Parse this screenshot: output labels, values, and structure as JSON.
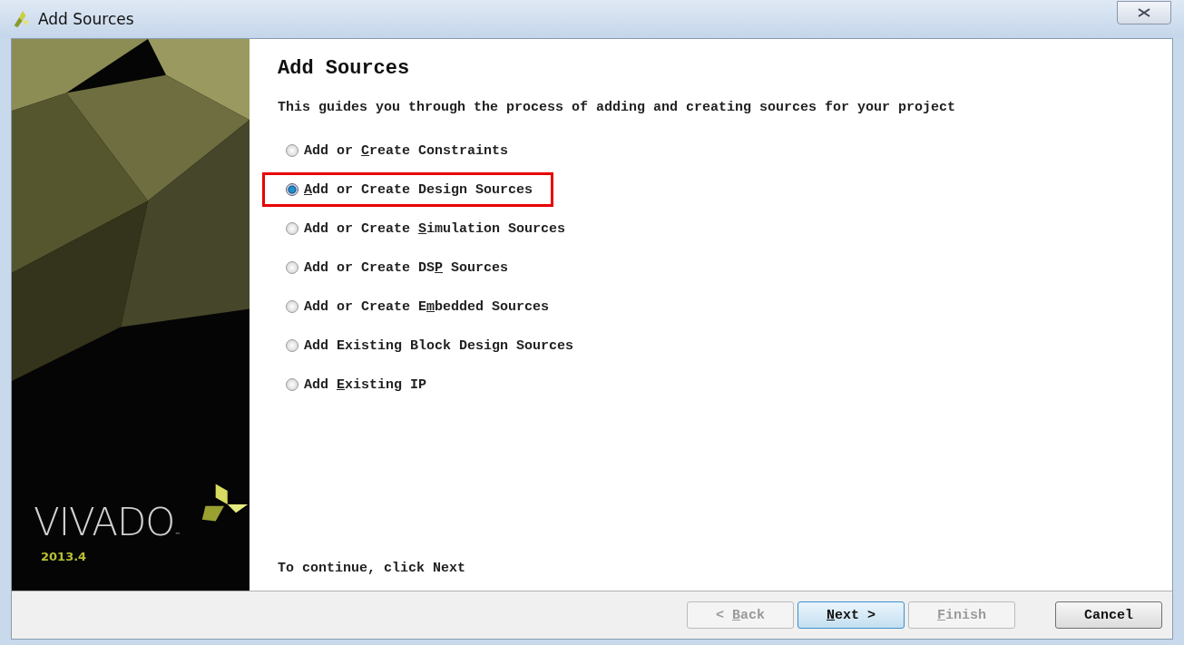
{
  "window": {
    "title": "Add Sources"
  },
  "sidebar": {
    "logo": "VIVADO",
    "trademark": "™",
    "version": "2013.4"
  },
  "heading": "Add Sources",
  "description": "This guides you through the process of adding and creating sources for your project",
  "options": [
    {
      "pre": "Add or ",
      "key": "C",
      "post": "reate Constraints",
      "selected": false,
      "highlighted": false
    },
    {
      "key": "A",
      "post": "dd or Create Design Sources",
      "selected": true,
      "highlighted": true
    },
    {
      "pre": "Add or Create ",
      "key": "S",
      "post": "imulation Sources",
      "selected": false,
      "highlighted": false
    },
    {
      "pre": "Add or Create DS",
      "key": "P",
      "post": " Sources",
      "selected": false,
      "highlighted": false
    },
    {
      "pre": "Add or Create E",
      "key": "m",
      "post": "bedded Sources",
      "selected": false,
      "highlighted": false
    },
    {
      "pre": "Add Existing Block Design Sources",
      "selected": false,
      "highlighted": false
    },
    {
      "pre": "Add ",
      "key": "E",
      "post": "xisting IP",
      "selected": false,
      "highlighted": false
    }
  ],
  "hint": "To continue, click Next",
  "buttons": [
    {
      "kind": "back",
      "pre": "< ",
      "key": "B",
      "post": "ack",
      "disabled": true,
      "default": false
    },
    {
      "kind": "next",
      "key": "N",
      "post": "ext >",
      "disabled": false,
      "default": true
    },
    {
      "kind": "finish",
      "key": "F",
      "post": "inish",
      "disabled": true,
      "default": false
    },
    {
      "kind": "cancel",
      "pre": "Cancel",
      "disabled": false,
      "default": false
    }
  ]
}
